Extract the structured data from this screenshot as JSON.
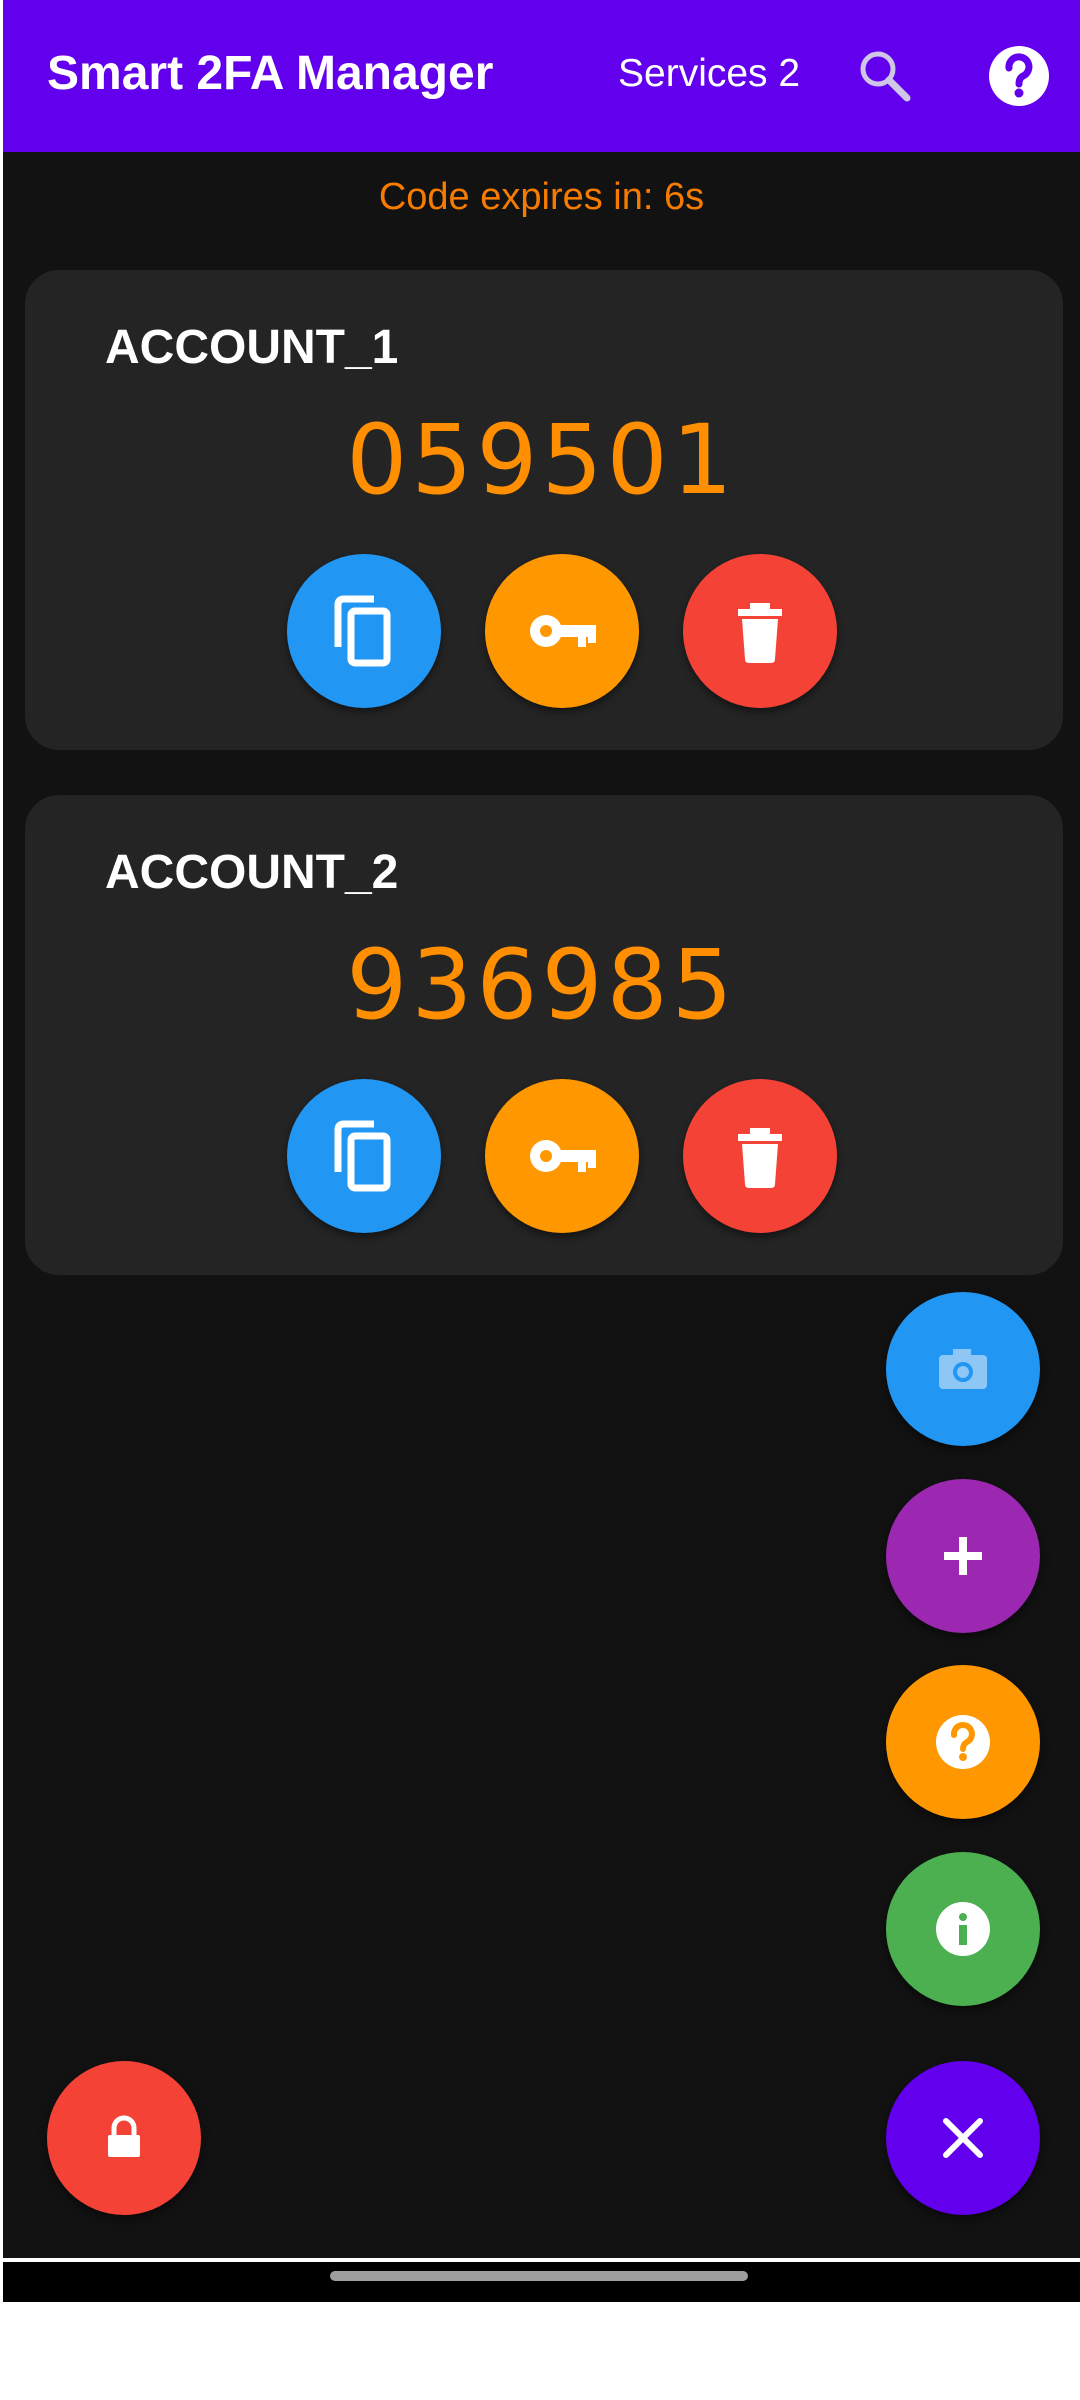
{
  "app_bar": {
    "title": "Smart 2FA Manager",
    "services_label": "Services 2",
    "icons": [
      "search-icon",
      "help-icon"
    ],
    "color": "#6200EE"
  },
  "timer": {
    "text": "Code expires in: 6s",
    "color": "#F57C00"
  },
  "accounts": [
    {
      "name": "ACCOUNT_1",
      "code": "059501"
    },
    {
      "name": "ACCOUNT_2",
      "code": "936985"
    }
  ],
  "card_actions": [
    {
      "icon": "copy-icon",
      "color": "#2196F3"
    },
    {
      "icon": "key-icon",
      "color": "#FF9800"
    },
    {
      "icon": "delete-icon",
      "color": "#F44336"
    }
  ],
  "fab_menu": [
    {
      "icon": "camera-icon",
      "color": "#2196F3"
    },
    {
      "icon": "plus-icon",
      "color": "#9C27B0"
    },
    {
      "icon": "question-icon",
      "color": "#FF9800"
    },
    {
      "icon": "info-icon",
      "color": "#4CAF50"
    },
    {
      "icon": "close-icon",
      "color": "#6200EE"
    }
  ],
  "lock_button": {
    "icon": "lock-icon",
    "color": "#F44336"
  }
}
